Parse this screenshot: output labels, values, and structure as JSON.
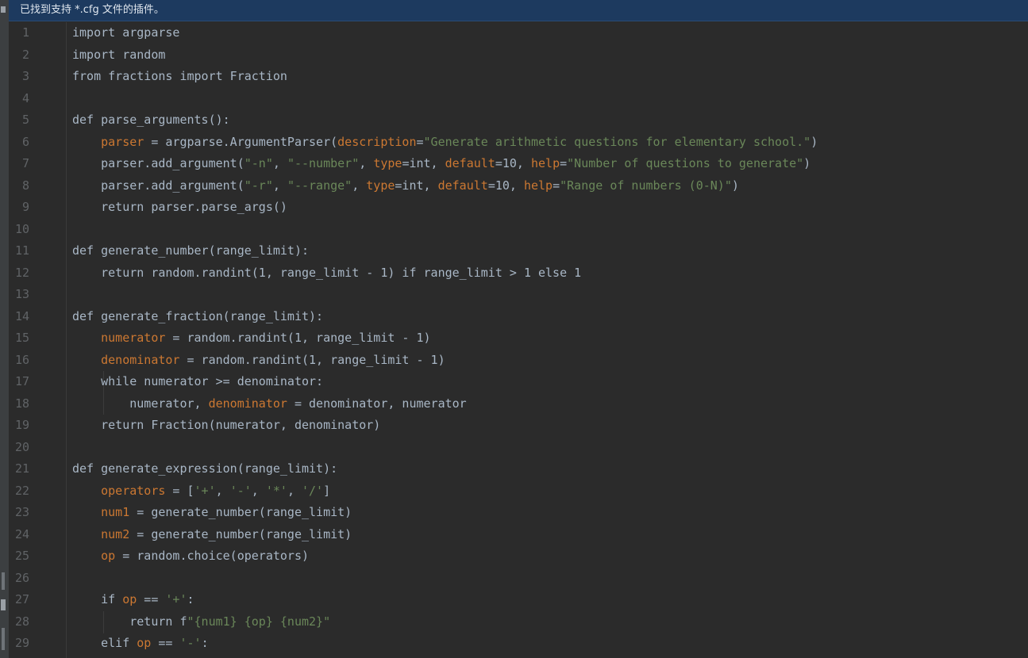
{
  "banner": {
    "message": "已找到支持 *.cfg 文件的插件。"
  },
  "colors": {
    "background": "#2b2b2b",
    "banner": "#1d3a5f",
    "plain": "#a9b7c6",
    "string": "#6a8759",
    "number": "#6897bb",
    "highlight_var": "#cc7832",
    "line_number": "#606366"
  },
  "editor": {
    "lines": [
      {
        "n": "1",
        "tokens": [
          {
            "t": "import argparse",
            "c": "plain"
          }
        ]
      },
      {
        "n": "2",
        "tokens": [
          {
            "t": "import random",
            "c": "plain"
          }
        ]
      },
      {
        "n": "3",
        "tokens": [
          {
            "t": "from fractions import Fraction",
            "c": "plain"
          }
        ]
      },
      {
        "n": "4",
        "tokens": []
      },
      {
        "n": "5",
        "tokens": [
          {
            "t": "def parse_arguments():",
            "c": "plain"
          }
        ]
      },
      {
        "n": "6",
        "tokens": [
          {
            "t": "    ",
            "c": "plain"
          },
          {
            "t": "parser",
            "c": "var"
          },
          {
            "t": " = argparse.ArgumentParser(",
            "c": "plain"
          },
          {
            "t": "description",
            "c": "var"
          },
          {
            "t": "=",
            "c": "plain"
          },
          {
            "t": "\"Generate arithmetic questions for elementary school.\"",
            "c": "str"
          },
          {
            "t": ")",
            "c": "plain"
          }
        ]
      },
      {
        "n": "7",
        "tokens": [
          {
            "t": "    parser.add_argument(",
            "c": "plain"
          },
          {
            "t": "\"-n\"",
            "c": "str"
          },
          {
            "t": ", ",
            "c": "plain"
          },
          {
            "t": "\"--number\"",
            "c": "str"
          },
          {
            "t": ", ",
            "c": "plain"
          },
          {
            "t": "type",
            "c": "var"
          },
          {
            "t": "=int, ",
            "c": "plain"
          },
          {
            "t": "default",
            "c": "var"
          },
          {
            "t": "=10, ",
            "c": "plain"
          },
          {
            "t": "help",
            "c": "var"
          },
          {
            "t": "=",
            "c": "plain"
          },
          {
            "t": "\"Number of questions to generate\"",
            "c": "str"
          },
          {
            "t": ")",
            "c": "plain"
          }
        ]
      },
      {
        "n": "8",
        "tokens": [
          {
            "t": "    parser.add_argument(",
            "c": "plain"
          },
          {
            "t": "\"-r\"",
            "c": "str"
          },
          {
            "t": ", ",
            "c": "plain"
          },
          {
            "t": "\"--range\"",
            "c": "str"
          },
          {
            "t": ", ",
            "c": "plain"
          },
          {
            "t": "type",
            "c": "var"
          },
          {
            "t": "=int, ",
            "c": "plain"
          },
          {
            "t": "default",
            "c": "var"
          },
          {
            "t": "=10, ",
            "c": "plain"
          },
          {
            "t": "help",
            "c": "var"
          },
          {
            "t": "=",
            "c": "plain"
          },
          {
            "t": "\"Range of numbers (0-N)\"",
            "c": "str"
          },
          {
            "t": ")",
            "c": "plain"
          }
        ]
      },
      {
        "n": "9",
        "tokens": [
          {
            "t": "    return parser.parse_args()",
            "c": "plain"
          }
        ]
      },
      {
        "n": "10",
        "tokens": []
      },
      {
        "n": "11",
        "tokens": [
          {
            "t": "def generate_number(range_limit):",
            "c": "plain"
          }
        ]
      },
      {
        "n": "12",
        "tokens": [
          {
            "t": "    return random.randint(1, range_limit - 1) if range_limit > 1 else 1",
            "c": "plain"
          }
        ]
      },
      {
        "n": "13",
        "tokens": []
      },
      {
        "n": "14",
        "tokens": [
          {
            "t": "def generate_fraction(range_limit):",
            "c": "plain"
          }
        ]
      },
      {
        "n": "15",
        "tokens": [
          {
            "t": "    ",
            "c": "plain"
          },
          {
            "t": "numerator",
            "c": "var"
          },
          {
            "t": " = random.randint(1, range_limit - 1)",
            "c": "plain"
          }
        ]
      },
      {
        "n": "16",
        "tokens": [
          {
            "t": "    ",
            "c": "plain"
          },
          {
            "t": "denominator",
            "c": "var"
          },
          {
            "t": " = random.randint(1, range_limit - 1)",
            "c": "plain"
          }
        ]
      },
      {
        "n": "17",
        "tokens": [
          {
            "t": "    while numerator >= denominator:",
            "c": "plain"
          }
        ]
      },
      {
        "n": "18",
        "tokens": [
          {
            "t": "        numerator, ",
            "c": "plain"
          },
          {
            "t": "denominator",
            "c": "var"
          },
          {
            "t": " = denominator, numerator",
            "c": "plain"
          }
        ]
      },
      {
        "n": "19",
        "tokens": [
          {
            "t": "    return Fraction(numerator, denominator)",
            "c": "plain"
          }
        ]
      },
      {
        "n": "20",
        "tokens": []
      },
      {
        "n": "21",
        "tokens": [
          {
            "t": "def generate_expression(range_limit):",
            "c": "plain"
          }
        ]
      },
      {
        "n": "22",
        "tokens": [
          {
            "t": "    ",
            "c": "plain"
          },
          {
            "t": "operators",
            "c": "var"
          },
          {
            "t": " = [",
            "c": "plain"
          },
          {
            "t": "'+'",
            "c": "str"
          },
          {
            "t": ", ",
            "c": "plain"
          },
          {
            "t": "'-'",
            "c": "str"
          },
          {
            "t": ", ",
            "c": "plain"
          },
          {
            "t": "'*'",
            "c": "str"
          },
          {
            "t": ", ",
            "c": "plain"
          },
          {
            "t": "'/'",
            "c": "str"
          },
          {
            "t": "]",
            "c": "plain"
          }
        ]
      },
      {
        "n": "23",
        "tokens": [
          {
            "t": "    ",
            "c": "plain"
          },
          {
            "t": "num1",
            "c": "var"
          },
          {
            "t": " = generate_number(range_limit)",
            "c": "plain"
          }
        ]
      },
      {
        "n": "24",
        "tokens": [
          {
            "t": "    ",
            "c": "plain"
          },
          {
            "t": "num2",
            "c": "var"
          },
          {
            "t": " = generate_number(range_limit)",
            "c": "plain"
          }
        ]
      },
      {
        "n": "25",
        "tokens": [
          {
            "t": "    ",
            "c": "plain"
          },
          {
            "t": "op",
            "c": "var"
          },
          {
            "t": " = random.choice(operators)",
            "c": "plain"
          }
        ]
      },
      {
        "n": "26",
        "tokens": []
      },
      {
        "n": "27",
        "tokens": [
          {
            "t": "    if ",
            "c": "plain"
          },
          {
            "t": "op",
            "c": "var"
          },
          {
            "t": " == ",
            "c": "plain"
          },
          {
            "t": "'+'",
            "c": "str"
          },
          {
            "t": ":",
            "c": "plain"
          }
        ]
      },
      {
        "n": "28",
        "tokens": [
          {
            "t": "        return f",
            "c": "plain"
          },
          {
            "t": "\"{num1} {op} {num2}\"",
            "c": "str"
          }
        ]
      },
      {
        "n": "29",
        "tokens": [
          {
            "t": "    elif ",
            "c": "plain"
          },
          {
            "t": "op",
            "c": "var"
          },
          {
            "t": " == ",
            "c": "plain"
          },
          {
            "t": "'-'",
            "c": "str"
          },
          {
            "t": ":",
            "c": "plain"
          }
        ]
      }
    ]
  }
}
